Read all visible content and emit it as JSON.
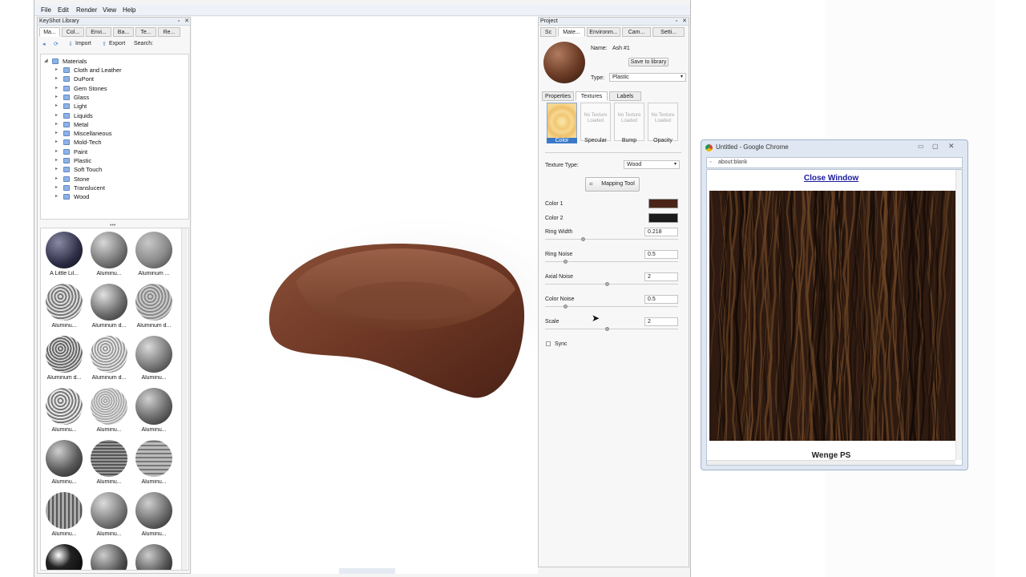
{
  "menu": [
    "File",
    "Edit",
    "Render",
    "View",
    "Help"
  ],
  "library": {
    "title": "KeyShot Library",
    "tabs": [
      "Ma...",
      "Col...",
      "Envi...",
      "Ba...",
      "Te...",
      "Re..."
    ],
    "toolbar": {
      "import": "Import",
      "export": "Export",
      "search_label": "Search:"
    },
    "tree_root": "Materials",
    "tree_items": [
      "Cloth and Leather",
      "DuPont",
      "Gem Stones",
      "Glass",
      "Light",
      "Liquids",
      "Metal",
      "Miscellaneous",
      "Mold-Tech",
      "Paint",
      "Plastic",
      "Soft Touch",
      "Stone",
      "Translucent",
      "Wood"
    ],
    "thumbs": [
      "A Little Lil...",
      "Aluminu...",
      "Aluminum ...",
      "Aluminu...",
      "Aluminum d...",
      "Aluminum d...",
      "Aluminum d...",
      "Aluminum d...",
      "Aluminu...",
      "Aluminu...",
      "Aluminu...",
      "Aluminu...",
      "Aluminu...",
      "Aluminu...",
      "Aluminu...",
      "Aluminu...",
      "Aluminu...",
      "Aluminu..."
    ]
  },
  "project": {
    "title": "Project",
    "tabs": [
      "Sc",
      "Mate...",
      "Environm...",
      "Cam...",
      "Setti..."
    ],
    "name_label": "Name:",
    "name_value": "Ash #1",
    "save_label": "Save to library",
    "type_label": "Type:",
    "type_value": "Plastic",
    "subtabs": [
      "Properties",
      "Textures",
      "Labels"
    ],
    "slots": [
      {
        "caption": "Color",
        "text": ""
      },
      {
        "caption": "Specular",
        "text": "No Texture Loaded"
      },
      {
        "caption": "Bump",
        "text": "No Texture Loaded"
      },
      {
        "caption": "Opacity",
        "text": "No Texture Loaded"
      }
    ],
    "texture_type_label": "Texture Type:",
    "texture_type_value": "Wood",
    "mapping_tool": "Mapping Tool",
    "color1_label": "Color 1",
    "color2_label": "Color 2",
    "color1": "#4a2518",
    "color2": "#1a1a1a",
    "params": [
      {
        "label": "Ring Width",
        "value": "0.218",
        "level": 0.3
      },
      {
        "label": "Ring Noise",
        "value": "0.5",
        "level": 0.15
      },
      {
        "label": "Axial Noise",
        "value": "2",
        "level": 0.5
      },
      {
        "label": "Color Noise",
        "value": "0.5",
        "level": 0.15
      },
      {
        "label": "Scale",
        "value": "2",
        "level": 0.5
      }
    ],
    "sync_label": "Sync"
  },
  "chrome": {
    "title": "Untitled - Google Chrome",
    "address": "about:blank",
    "close_link": "Close Window",
    "caption": "Wenge PS"
  },
  "colors": {
    "accent": "#1a1a9c",
    "wood_dark": "#2e1a10",
    "wood_light": "#6b4424",
    "bowl": "#7a4530"
  }
}
